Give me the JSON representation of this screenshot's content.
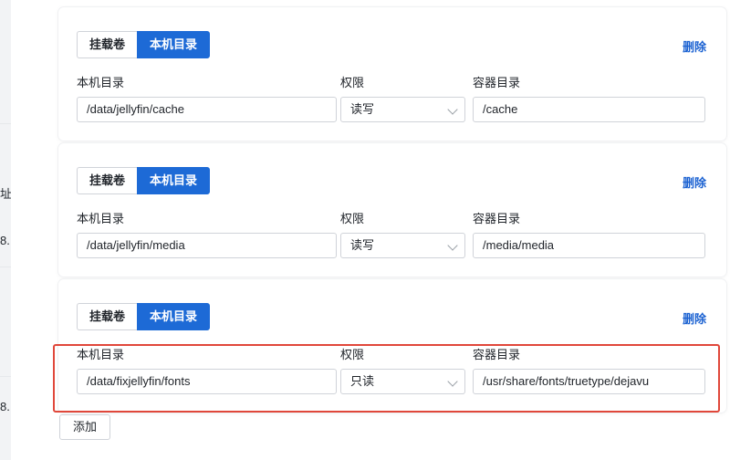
{
  "left_fragments": {
    "frag1": "址",
    "frag2": "8.",
    "frag3": "8."
  },
  "mounts": [
    {
      "tab_volume": "挂载卷",
      "tab_host_dir": "本机目录",
      "delete_label": "删除",
      "host_label": "本机目录",
      "perm_label": "权限",
      "container_label": "容器目录",
      "host_value": "/data/jellyfin/cache",
      "perm_value": "读写",
      "container_value": "/cache"
    },
    {
      "tab_volume": "挂载卷",
      "tab_host_dir": "本机目录",
      "delete_label": "删除",
      "host_label": "本机目录",
      "perm_label": "权限",
      "container_label": "容器目录",
      "host_value": "/data/jellyfin/media",
      "perm_value": "读写",
      "container_value": "/media/media"
    },
    {
      "tab_volume": "挂载卷",
      "tab_host_dir": "本机目录",
      "delete_label": "删除",
      "host_label": "本机目录",
      "perm_label": "权限",
      "container_label": "容器目录",
      "host_value": "/data/fixjellyfin/fonts",
      "perm_value": "只读",
      "container_value": "/usr/share/fonts/truetype/dejavu"
    }
  ],
  "add_button_label": "添加",
  "colors": {
    "accent": "#1d6ad6",
    "delete_link": "#1d63d2",
    "highlight_box": "#e0473a"
  }
}
